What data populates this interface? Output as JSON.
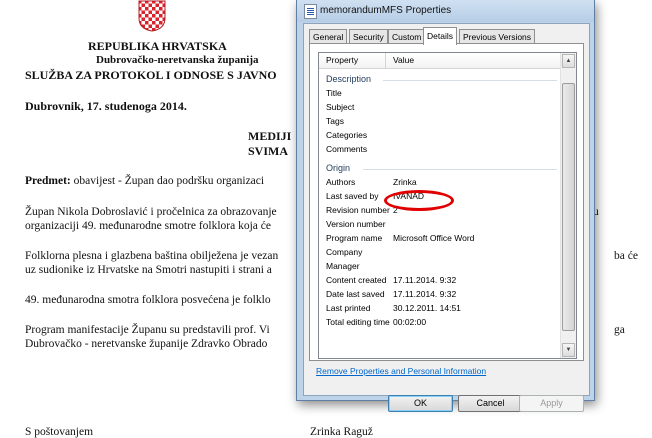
{
  "document": {
    "country": "REPUBLIKA HRVATSKA",
    "county": "Dubrovačko-neretvanska županija",
    "office": "SLUŽBA ZA PROTOKOL I ODNOSE S JAVNO",
    "date": "Dubrovnik,  17. studenoga 2014.",
    "recipient_1": "MEDIJI",
    "recipient_2": "SVIMA",
    "subject_label": "Predmet:",
    "subject_text": "obavijest -   Župan dao podršku organizaci",
    "p1_line1": "Župan Nikola Dobroslavić i pročelnica za obrazovanje",
    "p1_line1_end": "u",
    "p1_line2": "organizaciji 49. međunarodne smotre folklora koja će",
    "p2_line1": "Folklorna plesna i glazbena baština obilježena je vezan",
    "p2_line1_end": "ba će",
    "p2_line2": "uz sudionike iz Hrvatske na Smotri nastupiti i strani a",
    "p3_line1": "49. međunarodna smotra folklora posvećena je folklo",
    "p4_line1": "Program manifestacije Županu su predstavili prof. Vi",
    "p4_line1_end": "ga",
    "p4_line2": "Dubrovačko - neretvanske županije Zdravko Obrado",
    "closing": "S poštovanjem",
    "signature": "Zrinka Raguž"
  },
  "dialog": {
    "title": "memorandumMFS Properties",
    "tabs": [
      "General",
      "Security",
      "Custom",
      "Details",
      "Previous Versions"
    ],
    "active_tab": "Details",
    "columns": {
      "property": "Property",
      "value": "Value"
    },
    "sections": {
      "description": "Description",
      "origin": "Origin"
    },
    "description_props": [
      "Title",
      "Subject",
      "Tags",
      "Categories",
      "Comments"
    ],
    "origin_props": [
      {
        "property": "Authors",
        "value": "Zrinka"
      },
      {
        "property": "Last saved by",
        "value": "IVANAD"
      },
      {
        "property": "Revision number",
        "value": "2"
      },
      {
        "property": "Version number",
        "value": ""
      },
      {
        "property": "Program name",
        "value": "Microsoft Office Word"
      },
      {
        "property": "Company",
        "value": ""
      },
      {
        "property": "Manager",
        "value": ""
      },
      {
        "property": "Content created",
        "value": "17.11.2014. 9:32"
      },
      {
        "property": "Date last saved",
        "value": "17.11.2014. 9:32"
      },
      {
        "property": "Last printed",
        "value": "30.12.2011. 14:51"
      },
      {
        "property": "Total editing time",
        "value": "00:02:00"
      }
    ],
    "remove_link": "Remove Properties and Personal Information",
    "buttons": {
      "ok": "OK",
      "cancel": "Cancel",
      "apply": "Apply"
    },
    "annotation_color": "#e00000"
  }
}
